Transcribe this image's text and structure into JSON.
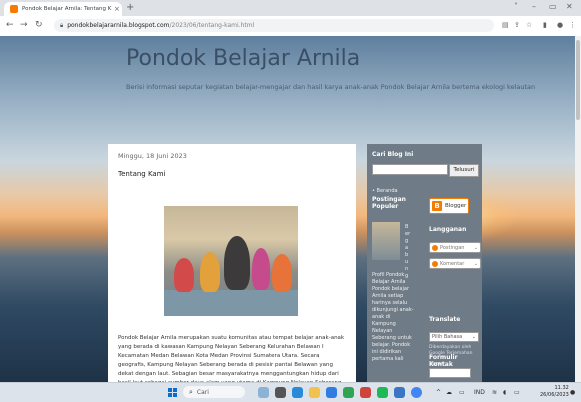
{
  "browser": {
    "tab_title": "Pondok Belajar Arnila: Tentang K",
    "url_host": "pondokbelajararnila.blogspot.com",
    "url_path": "/2023/06/tentang-kami.html",
    "new_tab_symbol": "+",
    "close_symbol": "×"
  },
  "blog": {
    "title": "Pondok Belajar Arnila",
    "description": "Berisi informasi seputar kegiatan belajar-mengajar dan hasil karya anak-anak Pondok Belajar Arnila bertema ekologi kelautan"
  },
  "post": {
    "date": "Minggu, 18 Juni 2023",
    "title": "Tentang Kami",
    "body": "Pondok Belajar Arnila merupakan suatu komunitas atau tempat belajar anak-anak yang berada di kawasan Kampung Nelayan Seberang Kelurahan Belawan I Kecamatan Medan Belawan Kota Medan Provinsi Sumatera Utara. Secara geografis, Kampung Nelayan Seberang berada di pesisir pantai Belawan yang dekat dengan laut. Sebagian besar masyarakatnya menggantungkan hidup dari hasil laut sebagai sumber daya alam yang utama di Kampung Nelayan Seberang merupakan salah satu kampung"
  },
  "sidebar": {
    "search_title": "Cari Blog Ini",
    "search_button": "Telusuri",
    "beranda": "Beranda",
    "popular_title": "Postingan Populer",
    "blogger_label": "Blogger",
    "popular_vertical": "Bergabung",
    "popular_post_text": "Profil Pondok Belajar Arnila Pondok belajar Arnila setiap harinya selalu dikunjungi anak-anak di Kampung Nelayan Seberang untuk belajar. Pondok ini didirikan pertama kali",
    "subscribe_title": "Langganan",
    "sub_posts": "Postingan",
    "sub_comments": "Komentar",
    "translate_title": "Translate",
    "translate_select": "Pilih Bahasa",
    "translate_powered": "Diberdayakan oleh Google Terjemahan",
    "contact_title": "Formulir Kontak",
    "contact_name_label": "Nama"
  },
  "taskbar": {
    "search_label": "Cari",
    "clock_time": "11.32",
    "clock_date": "26/06/2023",
    "lang": "IND"
  },
  "colors": {
    "blogger_orange": "#f57c00",
    "windows_blue": "#0a6ed1"
  }
}
